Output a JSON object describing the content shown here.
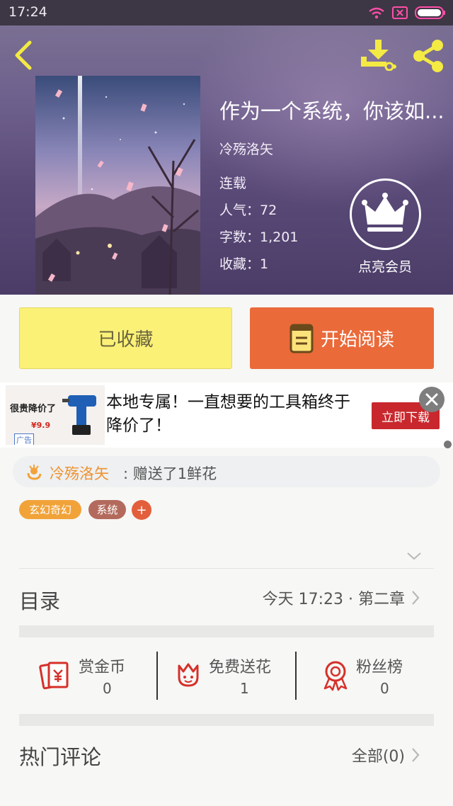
{
  "status_bar": {
    "time": "17:24",
    "icons": [
      "wifi-icon",
      "sim-icon",
      "battery-icon"
    ]
  },
  "header": {
    "back_icon": "chevron-left-icon",
    "download_icon": "download-icon",
    "share_icon": "share-icon",
    "icon_color": "#f4ea44"
  },
  "book": {
    "title": "作为一个系统，你该如...",
    "author": "冷殇洛矢",
    "status": "连载",
    "popularity_label": "人气",
    "popularity": "72",
    "word_count_label": "字数",
    "word_count": "1,201",
    "favorites_label": "收藏",
    "favorites": "1",
    "stat_separator": "："
  },
  "vip": {
    "icon": "crown-icon",
    "label": "点亮会员"
  },
  "actions": {
    "collected_label": "已收藏",
    "read_label": "开始阅读",
    "read_icon": "book-icon",
    "collected_color": "#fbf177",
    "read_color": "#ea6a3a"
  },
  "ad": {
    "thumb_headline": "很贵降价了",
    "thumb_price": "¥9.9",
    "tag": "广告",
    "text": "本地专属！一直想要的工具箱终于降价了！",
    "cta": "立即下载",
    "close_icon": "close-icon"
  },
  "gift": {
    "icon": "flower-icon",
    "user": "冷殇洛矢",
    "message": ": 赠送了1鲜花"
  },
  "tags": [
    "玄幻奇幻",
    "系统"
  ],
  "tag_add_label": "+",
  "toc": {
    "title": "目录",
    "latest": "今天 17:23 · 第二章"
  },
  "stats": [
    {
      "name": "赏金币",
      "count": "0",
      "icon": "reward-coin-icon"
    },
    {
      "name": "免费送花",
      "count": "1",
      "icon": "flower-icon"
    },
    {
      "name": "粉丝榜",
      "count": "0",
      "icon": "medal-icon"
    }
  ],
  "comments": {
    "title": "热门评论",
    "all_label": "全部(0)"
  }
}
